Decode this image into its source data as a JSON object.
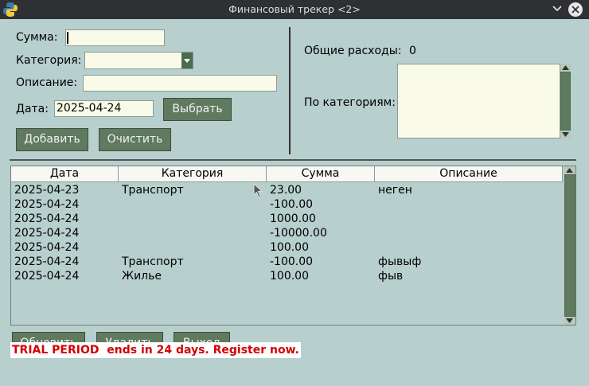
{
  "window": {
    "title": "Финансовый трекер <2>"
  },
  "form": {
    "amount_label": "Сумма:",
    "amount_value": "",
    "category_label": "Категория:",
    "category_value": "",
    "description_label": "Описание:",
    "description_value": "",
    "date_label": "Дата:",
    "date_value": "2025-04-24",
    "choose_button": "Выбрать",
    "add_button": "Добавить",
    "clear_button": "Очистить"
  },
  "summary": {
    "total_label": "Общие расходы:",
    "total_value": "0",
    "by_category_label": "По категориям:"
  },
  "table": {
    "columns": [
      "Дата",
      "Категория",
      "Сумма",
      "Описание"
    ],
    "rows": [
      [
        "2025-04-23",
        "Транспорт",
        "23.00",
        "неген"
      ],
      [
        "2025-04-24",
        "",
        "-100.00",
        ""
      ],
      [
        "2025-04-24",
        "",
        "1000.00",
        ""
      ],
      [
        "2025-04-24",
        "",
        "-10000.00",
        ""
      ],
      [
        "2025-04-24",
        "",
        "100.00",
        ""
      ],
      [
        "2025-04-24",
        "Транспорт",
        "-100.00",
        "фывыф"
      ],
      [
        "2025-04-24",
        "Жилье",
        "100.00",
        "фыв"
      ]
    ]
  },
  "actions": {
    "refresh_button": "Обновить",
    "delete_button": "Удалить",
    "exit_button": "Выход"
  },
  "trial": {
    "text": "TRIAL PERIOD  ends in 24 days. Register now."
  },
  "colors": {
    "background": "#b7cfcd",
    "button": "#5f7a5f",
    "trial_text": "#d40000"
  },
  "icons": {
    "app": "python-icon",
    "minimize": "chevron-down-icon",
    "close": "close-icon",
    "mouse": "mouse-cursor-icon"
  }
}
